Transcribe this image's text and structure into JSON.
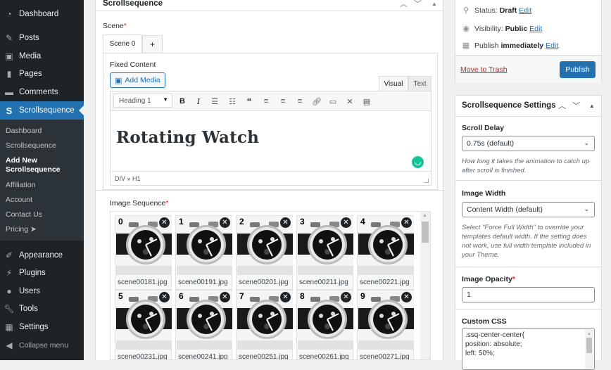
{
  "sidebar": {
    "items": [
      {
        "label": "Dashboard",
        "icon": "dashboard-icon"
      },
      {
        "label": "Posts",
        "icon": "pin-icon"
      },
      {
        "label": "Media",
        "icon": "media-icon"
      },
      {
        "label": "Pages",
        "icon": "pages-icon"
      },
      {
        "label": "Comments",
        "icon": "comment-icon"
      },
      {
        "label": "Scrollsequence",
        "icon": "scrollsequence-icon",
        "active": true
      },
      {
        "label": "Appearance",
        "icon": "brush-icon"
      },
      {
        "label": "Plugins",
        "icon": "plugin-icon"
      },
      {
        "label": "Users",
        "icon": "user-icon"
      },
      {
        "label": "Tools",
        "icon": "wrench-icon"
      },
      {
        "label": "Settings",
        "icon": "settings-icon"
      }
    ],
    "submenu": [
      {
        "label": "Dashboard"
      },
      {
        "label": "Scrollsequence"
      },
      {
        "label": "Add New Scrollsequence",
        "current": true
      },
      {
        "label": "Affiliation"
      },
      {
        "label": "Account"
      },
      {
        "label": "Contact Us"
      },
      {
        "label": "Pricing ➤"
      }
    ],
    "collapse_label": "Collapse menu"
  },
  "main": {
    "panel_title": "Scrollsequence",
    "scene_label": "Scene",
    "required_mark": "*",
    "tabs": [
      {
        "label": "Scene 0"
      },
      {
        "label": "+"
      }
    ],
    "fixed_content_label": "Fixed Content",
    "add_media_label": "Add Media",
    "editor_tabs": {
      "visual": "Visual",
      "text": "Text"
    },
    "format_select": "Heading 1",
    "content_heading": "Rotating Watch",
    "path": "DIV » H1",
    "image_sequence_label": "Image Sequence",
    "images": [
      {
        "index": "0",
        "file": "scene00181.jpg"
      },
      {
        "index": "1",
        "file": "scene00191.jpg"
      },
      {
        "index": "2",
        "file": "scene00201.jpg"
      },
      {
        "index": "3",
        "file": "scene00211.jpg"
      },
      {
        "index": "4",
        "file": "scene00221.jpg"
      },
      {
        "index": "5",
        "file": "scene00231.jpg"
      },
      {
        "index": "6",
        "file": "scene00241.jpg"
      },
      {
        "index": "7",
        "file": "scene00251.jpg"
      },
      {
        "index": "8",
        "file": "scene00261.jpg"
      },
      {
        "index": "9",
        "file": "scene00271.jpg"
      }
    ]
  },
  "publish": {
    "status_label": "Status:",
    "status_value": "Draft",
    "visibility_label": "Visibility:",
    "visibility_value": "Public",
    "publish_label": "Publish",
    "publish_value": "immediately",
    "edit_label": "Edit",
    "trash_label": "Move to Trash",
    "publish_button": "Publish"
  },
  "settings": {
    "title": "Scrollsequence Settings",
    "scroll_delay_label": "Scroll Delay",
    "scroll_delay_value": "0.75s (default)",
    "scroll_delay_desc": "How long it takes the animation to catch up after scroll is finished.",
    "image_width_label": "Image Width",
    "image_width_value": "Content Width (default)",
    "image_width_desc": "Select \"Force Full Width\" to override your templates default width. If the setting does not work, use full width template included in your Theme.",
    "opacity_label": "Image Opacity",
    "opacity_value": "1",
    "css_label": "Custom CSS",
    "css_lines": [
      ".ssq-center-center{",
      "position: absolute;",
      "left: 50%;"
    ]
  },
  "colors": {
    "accent": "#2271b1",
    "sidebar_bg": "#1d2327",
    "submenu_bg": "#2c3338",
    "trash": "#b32d2e",
    "grammarly": "#15c39a"
  }
}
